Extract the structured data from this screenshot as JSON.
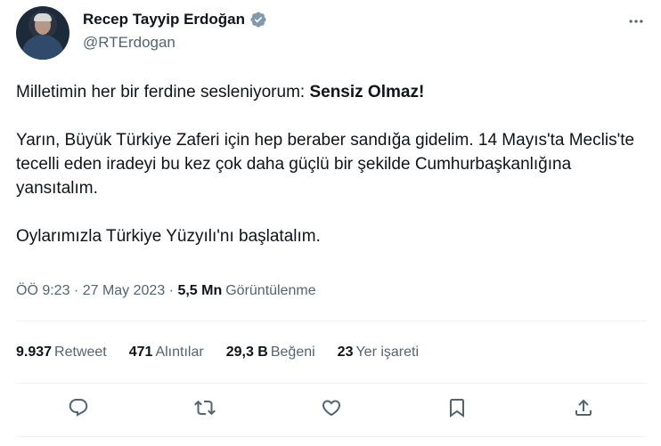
{
  "author": {
    "name": "Recep Tayyip Erdoğan",
    "handle": "@RTErdogan",
    "verified_color": "#829aab"
  },
  "tweet": {
    "line1_prefix": "Milletimin her bir ferdine sesleniyorum: ",
    "line1_bold": "Sensiz Olmaz!",
    "paragraph2": "Yarın, Büyük Türkiye Zaferi için hep beraber sandığa gidelim. 14 Mayıs'ta Meclis'te tecelli eden iradeyi bu kez çok daha güçlü bir şekilde Cumhurbaşkanlığına yansıtalım.",
    "paragraph3": "Oylarımızla Türkiye Yüzyılı'nı başlatalım."
  },
  "meta": {
    "time": "ÖÖ 9:23",
    "separator": " · ",
    "date": "27 May 2023",
    "separator2": " · ",
    "views_count": "5,5 Mn",
    "views_label": "Görüntülenme"
  },
  "stats": [
    {
      "num": "9.937",
      "label": "Retweet"
    },
    {
      "num": "471",
      "label": "Alıntılar"
    },
    {
      "num": "29,3 B",
      "label": "Beğeni"
    },
    {
      "num": "23",
      "label": "Yer işareti"
    }
  ],
  "actions": [
    "reply-icon",
    "retweet-icon",
    "like-icon",
    "bookmark-icon",
    "share-icon"
  ],
  "colors": {
    "text": "#0f1419",
    "secondary": "#536471",
    "divider": "#eff3f4"
  }
}
